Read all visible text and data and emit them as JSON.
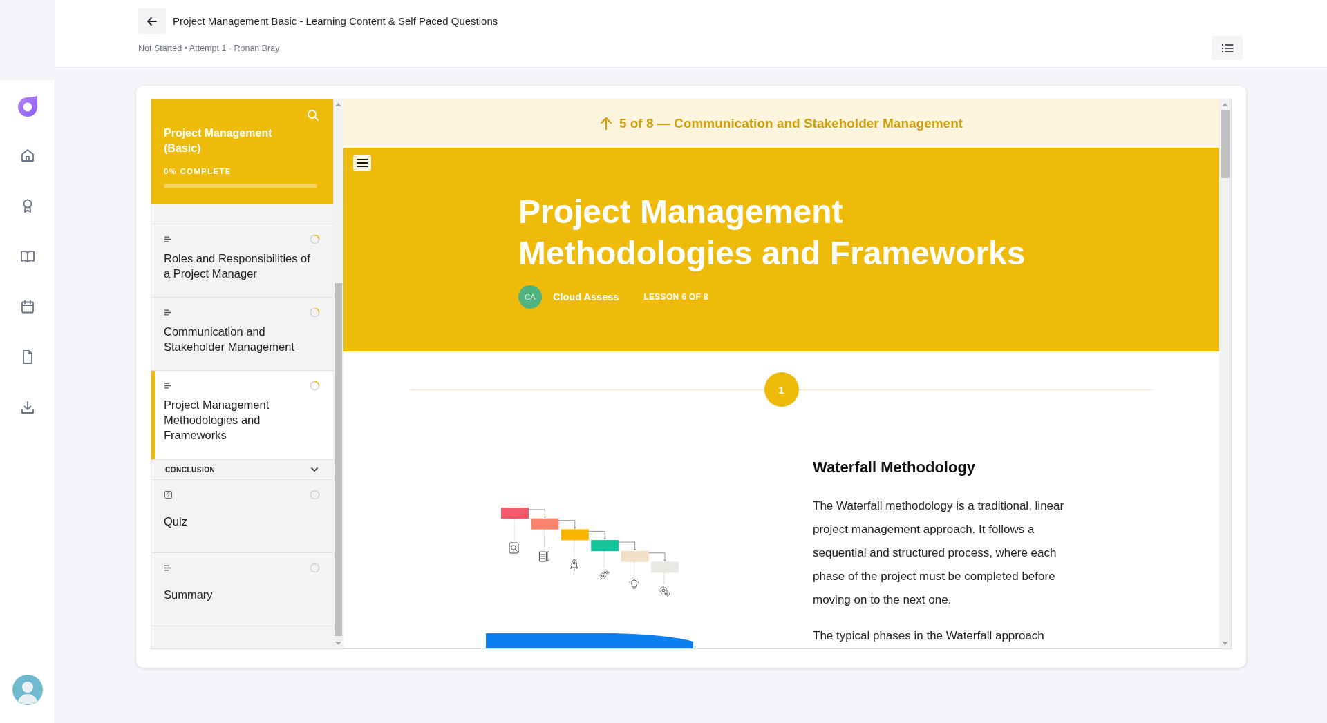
{
  "header": {
    "title": "Project Management Basic - Learning Content & Self Paced Questions",
    "status": "Not Started • Attempt 1 · Ronan Bray"
  },
  "course": {
    "title": "Project Management (Basic)",
    "progress_label": "0% COMPLETE",
    "level": 0
  },
  "outline": {
    "lessons": [
      {
        "kind": "lesson",
        "title": "Roles and Responsibilities of a Project Manager",
        "started": true,
        "selected": false
      },
      {
        "kind": "lesson",
        "title": "Communication and Stakeholder Management",
        "started": true,
        "selected": false
      },
      {
        "kind": "lesson",
        "title": "Project Management Methodologies and Frameworks",
        "started": true,
        "selected": true
      }
    ],
    "sections": [
      {
        "title": "CONCLUSION",
        "expanded": true,
        "children": [
          {
            "kind": "quiz",
            "title": "Quiz",
            "started": false,
            "selected": false
          },
          {
            "kind": "lesson",
            "title": "Summary",
            "started": false,
            "selected": false
          }
        ]
      }
    ]
  },
  "lesson_nav": {
    "label": "5 of 8 — Communication and Stakeholder Management"
  },
  "banner": {
    "title": "Project Management Methodologies and Frameworks",
    "author_initials": "CA",
    "author": "Cloud Assess",
    "lesson_counter": "LESSON 6 OF 8"
  },
  "content": {
    "step": "1",
    "heading": "Waterfall Methodology",
    "paragraphs": [
      "The Waterfall methodology is a traditional, linear project management approach. It follows a sequential and structured process, where each phase of the project must be completed before moving on to the next one.",
      "The typical phases in the Waterfall approach"
    ]
  }
}
